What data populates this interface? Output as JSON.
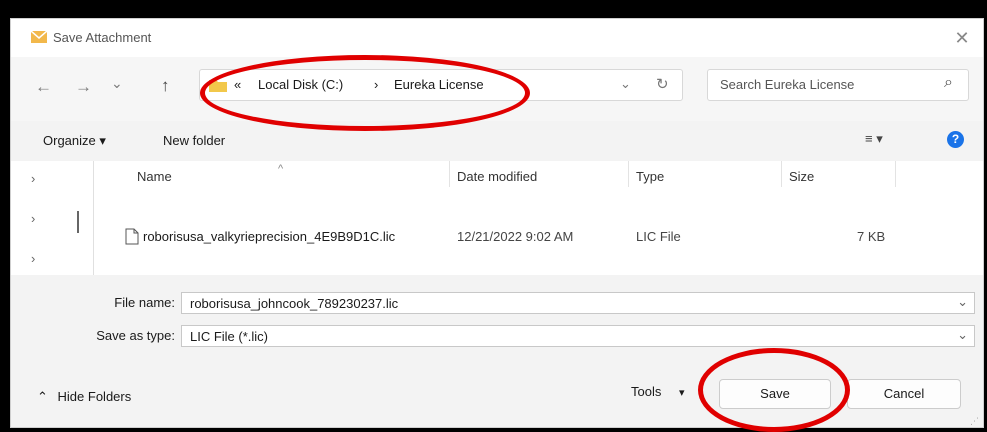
{
  "window": {
    "title": "Save Attachment",
    "close_glyph": "✕"
  },
  "nav": {
    "back_glyph": "←",
    "forward_glyph": "→",
    "recent_glyph": "⌄",
    "up_glyph": "↑",
    "breadcrumb_prefix": "«",
    "breadcrumb": [
      "Local Disk (C:)",
      "Eureka License"
    ],
    "breadcrumb_sep": "›",
    "address_dropdown_glyph": "⌄",
    "refresh_glyph": "↻",
    "search_placeholder": "Search Eureka License",
    "search_glyph": "⌕"
  },
  "toolbar": {
    "organize": "Organize ▾",
    "new_folder": "New folder",
    "view_glyph": "≡ ▾",
    "help_glyph": "?"
  },
  "columns": {
    "name": "Name",
    "date": "Date modified",
    "type": "Type",
    "size": "Size"
  },
  "files": [
    {
      "name": "roborisusa_valkyrieprecision_4E9B9D1C.lic",
      "date": "12/21/2022 9:02 AM",
      "type": "LIC File",
      "size": "7 KB"
    }
  ],
  "form": {
    "file_name_label": "File name:",
    "file_name_value": "roborisusa_johncook_789230237.lic",
    "save_type_label": "Save as type:",
    "save_type_value": "LIC File (*.lic)",
    "dropdown_glyph": "⌄"
  },
  "footer": {
    "hide_folders": "Hide Folders",
    "hide_glyph": "⌃",
    "tools": "Tools",
    "tools_glyph": "▾",
    "save": "Save",
    "cancel": "Cancel"
  },
  "colors": {
    "highlight": "#e00000",
    "help": "#1a73e8",
    "folder": "#f2c84b"
  }
}
